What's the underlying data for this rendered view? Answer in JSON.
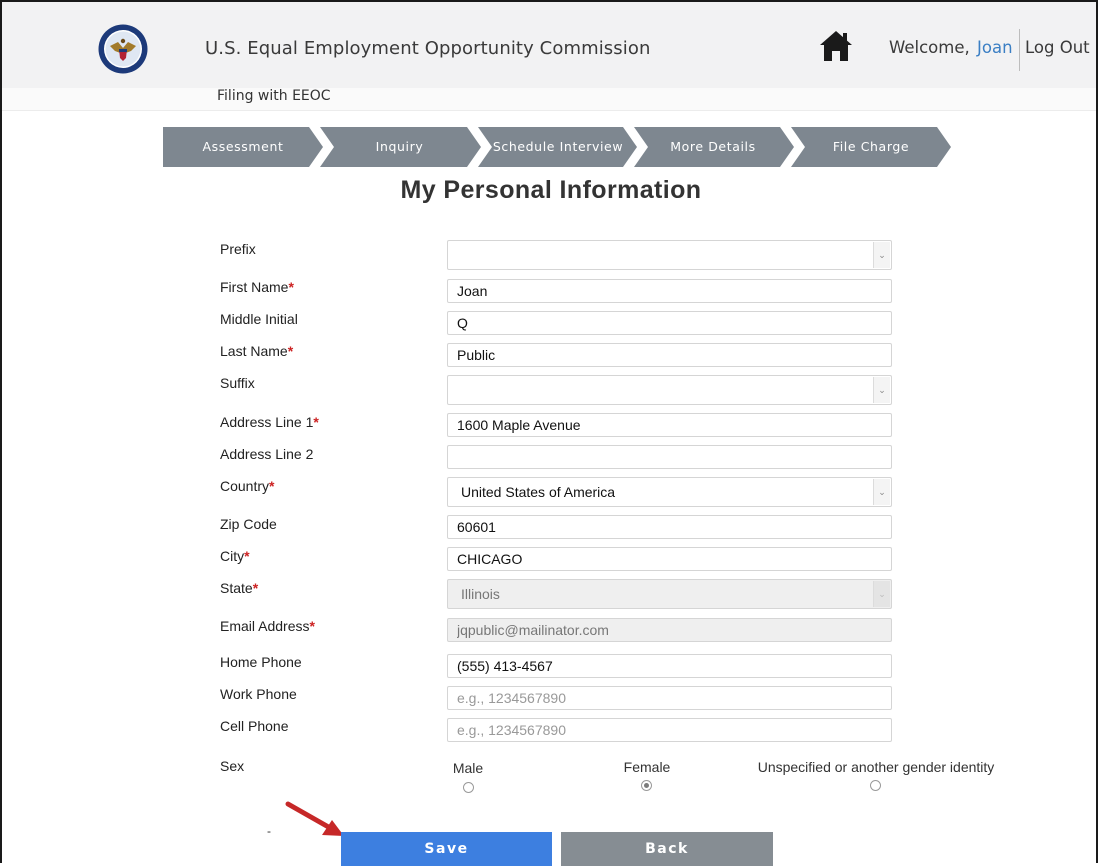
{
  "header": {
    "agency_name": "U.S. Equal Employment Opportunity Commission",
    "welcome_text": "Welcome,",
    "user_name": "Joan",
    "logout_label": "Log Out",
    "sub_title": "Filing with EEOC",
    "seal_icon": "eeoc-seal-icon",
    "home_icon": "home-icon"
  },
  "steps": [
    {
      "label": "Assessment"
    },
    {
      "label": "Inquiry"
    },
    {
      "label": "Schedule Interview"
    },
    {
      "label": "More Details"
    },
    {
      "label": "File Charge"
    }
  ],
  "page_title": "My Personal Information",
  "form": {
    "prefix": {
      "label": "Prefix",
      "value": ""
    },
    "first_name": {
      "label": "First Name",
      "value": "Joan"
    },
    "middle_initial": {
      "label": "Middle Initial",
      "value": "Q"
    },
    "last_name": {
      "label": "Last Name",
      "value": "Public"
    },
    "suffix": {
      "label": "Suffix",
      "value": ""
    },
    "address1": {
      "label": "Address Line 1",
      "value": "1600 Maple Avenue"
    },
    "address2": {
      "label": "Address Line 2",
      "value": ""
    },
    "country": {
      "label": "Country",
      "value": "United States of America"
    },
    "zip": {
      "label": "Zip Code",
      "value": "60601"
    },
    "city": {
      "label": "City",
      "value": "CHICAGO"
    },
    "state": {
      "label": "State",
      "value": "Illinois"
    },
    "email": {
      "label": "Email Address",
      "value": "jqpublic@mailinator.com"
    },
    "home_phone": {
      "label": "Home Phone",
      "value": "(555) 413-4567"
    },
    "work_phone": {
      "label": "Work Phone",
      "placeholder": "e.g., 1234567890"
    },
    "cell_phone": {
      "label": "Cell Phone",
      "placeholder": "e.g., 1234567890"
    },
    "required_mark": "*",
    "sex": {
      "label": "Sex",
      "options": [
        "Male",
        "Female",
        "Unspecified or another gender identity"
      ],
      "selected": "Female"
    }
  },
  "buttons": {
    "save_label": "Save",
    "back_label": "Back"
  },
  "misc": {
    "dash": "-"
  },
  "colors": {
    "step_bg": "#7e8790",
    "save": "#3d7fe0",
    "back": "#868d93",
    "required": "#cc2222",
    "link": "#3b7fc4",
    "arrow": "#c62828"
  }
}
